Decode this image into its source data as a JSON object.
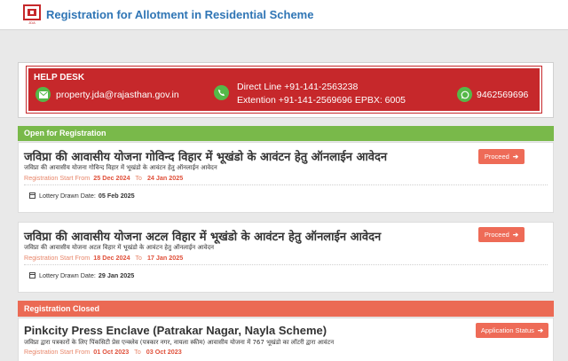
{
  "header": {
    "title": "Registration for Allotment in Residential Scheme",
    "logo_icon": "jda-logo-icon"
  },
  "help_desk": {
    "title": "HELP DESK",
    "email": "property.jda@rajasthan.gov.in",
    "direct_line": "Direct Line +91-141-2563238",
    "extension": "Extention   +91-141-2569696 EPBX: 6005",
    "whatsapp": "9462569696",
    "accent_color": "#c6282b",
    "icon_green": "#55b848"
  },
  "open_section": {
    "header": "Open for Registration",
    "color": "#79b94a",
    "schemes": [
      {
        "title": "जविप्रा की आवासीय योजना गोविन्द विहार में भूखंडो के आवंटन हेतु ऑनलाईन आवेदन",
        "subtitle": "जविप्रा की आवासीय योजना गोविन्द विहार में भूखंडो के आवंटन हेतु ऑनलाईन आवेदन",
        "reg_start_label": "Registration Start From",
        "reg_start": "25 Dec 2024",
        "to_label": "To",
        "reg_end": "24 Jan 2025",
        "lottery_label": "Lottery Drawn Date:",
        "lottery_date": "05 Feb 2025",
        "button": "Proceed"
      },
      {
        "title": "जविप्रा की आवासीय योजना अटल विहार में भूखंडो के आवंटन हेतु ऑनलाईन आवेदन",
        "subtitle": "जविप्रा की आवासीय योजना अटल विहार में भूखंडो के आवंटन हेतु ऑनलाईन आवेदन",
        "reg_start_label": "Registration Start From",
        "reg_start": "18 Dec 2024",
        "to_label": "To",
        "reg_end": "17 Jan 2025",
        "lottery_label": "Lottery Drawn Date:",
        "lottery_date": "29 Jan 2025",
        "button": "Proceed"
      }
    ]
  },
  "closed_section": {
    "header": "Registration Closed",
    "color": "#eb6a54",
    "schemes": [
      {
        "title": "Pinkcity Press Enclave (Patrakar Nagar, Nayla Scheme)",
        "subtitle": "जविप्रा द्वारा पत्रकारों के लिए पिंकसिटी प्रेस एन्क्लेव (पत्रकार नगर, नायला स्कीम) आवासीय योजना में 767 भूखंडो का लॉटरी द्वारा आवंटन",
        "reg_start_label": "Registration Start From",
        "reg_start": "01 Oct 2023",
        "to_label": "To",
        "reg_end": "03 Oct 2023",
        "button": "Application Status"
      }
    ]
  }
}
